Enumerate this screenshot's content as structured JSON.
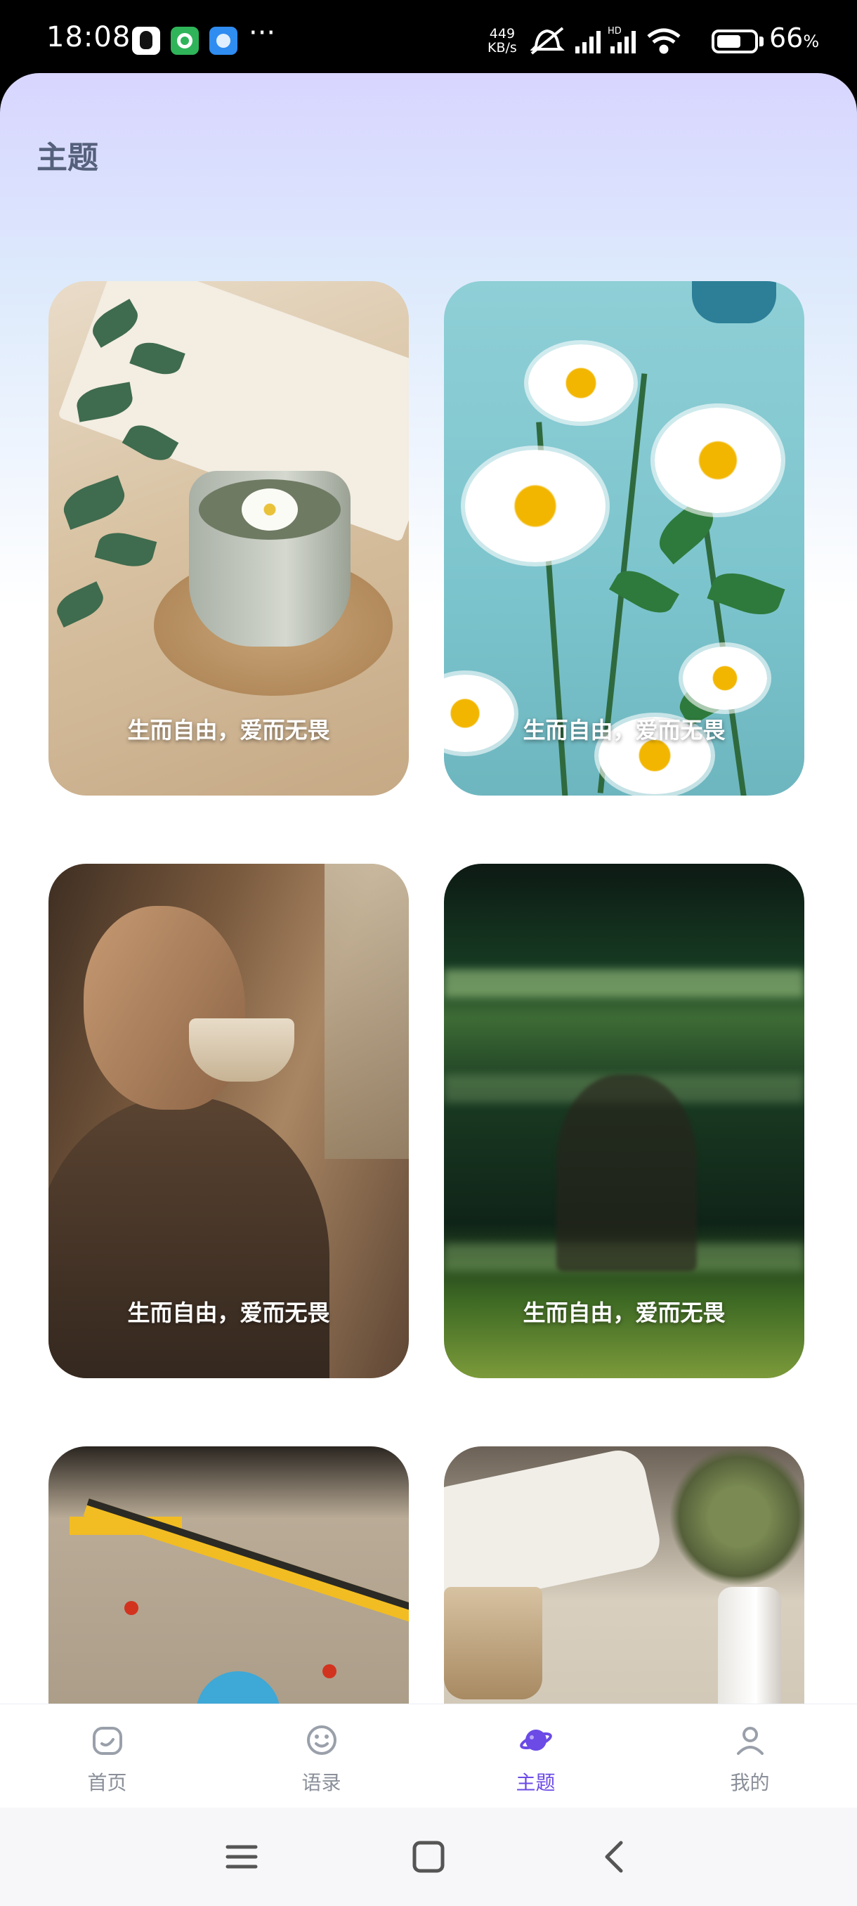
{
  "status_bar": {
    "time": "18:08",
    "net_speed_value": "449",
    "net_speed_unit": "KB/s",
    "battery_percent": "66",
    "battery_symbol": "%",
    "more_dots": "···",
    "battery_level": 0.66,
    "hd_label": "HD"
  },
  "header": {
    "title": "主题"
  },
  "cards": [
    {
      "caption": "生而自由，爱而无畏"
    },
    {
      "caption": "生而自由，爱而无畏"
    },
    {
      "caption": "生而自由，爱而无畏"
    },
    {
      "caption": "生而自由，爱而无畏"
    }
  ],
  "tabs": [
    {
      "label": "首页",
      "icon": "home-icon"
    },
    {
      "label": "语录",
      "icon": "quote-icon"
    },
    {
      "label": "主题",
      "icon": "planet-icon",
      "active": true
    },
    {
      "label": "我的",
      "icon": "profile-icon"
    }
  ],
  "colors": {
    "accent": "#6b4ae6",
    "tab_inactive": "#8a8f99",
    "title": "#55607a"
  }
}
